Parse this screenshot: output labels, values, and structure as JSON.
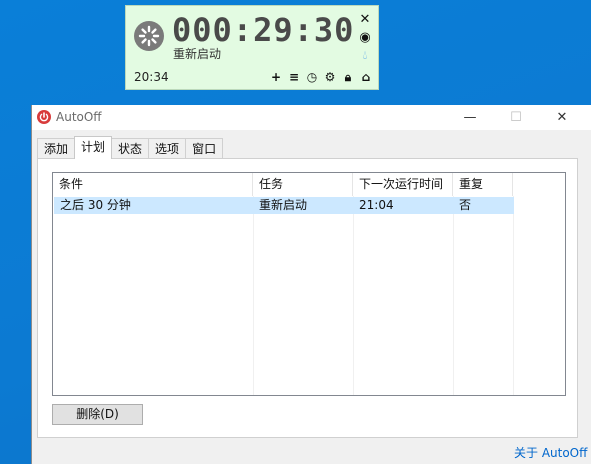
{
  "widget": {
    "countdown": "000:29:30",
    "task": "重新启动",
    "clock": "20:34",
    "side_icons": [
      "close-icon",
      "eye-icon",
      "drop-icon"
    ],
    "toolbar_icons": [
      "add-icon",
      "menu-icon",
      "clock-icon",
      "gear-icon",
      "lock-icon",
      "home-icon"
    ]
  },
  "window": {
    "title": "AutoOff",
    "tabs": [
      "添加",
      "计划",
      "状态",
      "选项",
      "窗口"
    ],
    "active_tab": 1,
    "columns": [
      "条件",
      "任务",
      "下一次运行时间",
      "重复"
    ],
    "rows": [
      [
        "之后 30 分钟",
        "重新启动",
        "21:04",
        "否"
      ]
    ],
    "delete_button": "删除(D)",
    "about_link": "关于 AutoOff"
  },
  "colors": {
    "widget_bg": "#e3fbe2",
    "selection": "#cce8ff",
    "desktop": "#0a7fd8",
    "link": "#0066cc"
  }
}
